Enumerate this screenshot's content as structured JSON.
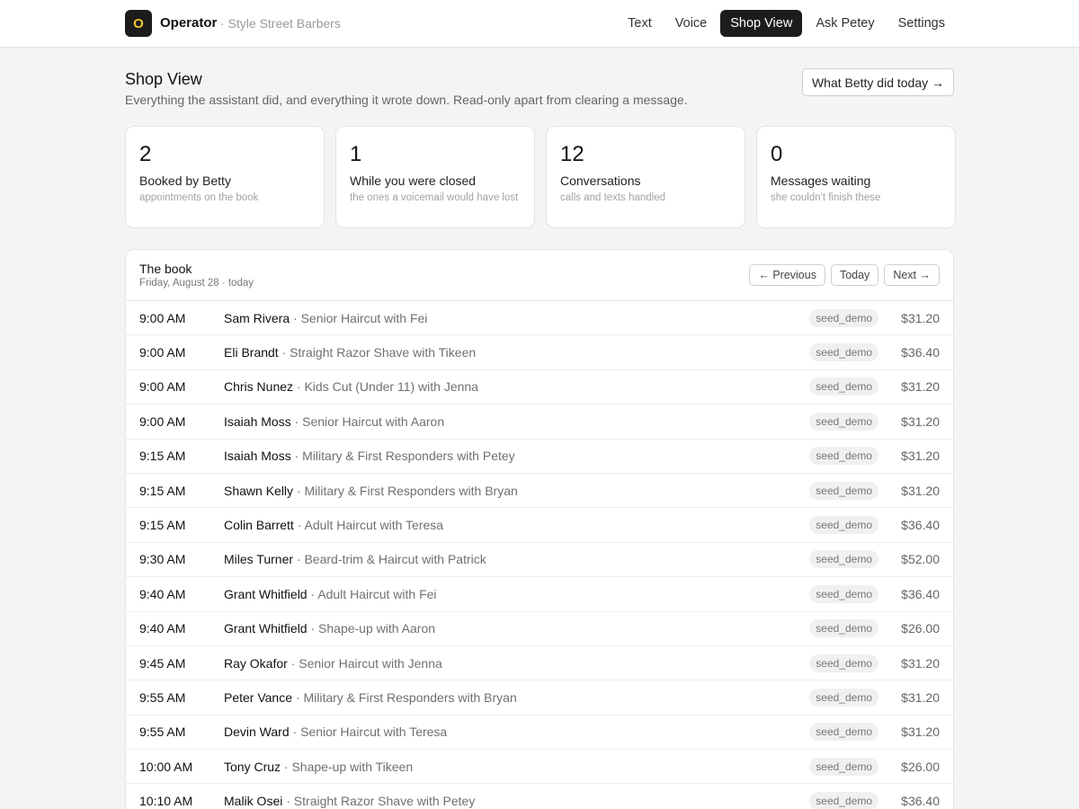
{
  "app": {
    "logo_letter": "O",
    "name": "Operator",
    "shop": "· Style Street Barbers"
  },
  "nav": [
    {
      "label": "Text",
      "active": false
    },
    {
      "label": "Voice",
      "active": false
    },
    {
      "label": "Shop View",
      "active": true
    },
    {
      "label": "Ask Petey",
      "active": false
    },
    {
      "label": "Settings",
      "active": false
    }
  ],
  "header": {
    "title": "Shop View",
    "subtitle": "Everything the assistant did, and everything it wrote down. Read-only apart from clearing a message.",
    "today_button": "What Betty did today →"
  },
  "stats": [
    {
      "value": "2",
      "label": "Booked by Betty",
      "hint": "appointments on the book"
    },
    {
      "value": "1",
      "label": "While you were closed",
      "hint": "the ones a voicemail would have lost"
    },
    {
      "value": "12",
      "label": "Conversations",
      "hint": "calls and texts handled"
    },
    {
      "value": "0",
      "label": "Messages waiting",
      "hint": "she couldn't finish these"
    }
  ],
  "book": {
    "title": "The book",
    "date": "Friday, August 28 · today",
    "prev": "← Previous",
    "today": "Today",
    "next": "Next →",
    "rows": [
      {
        "time": "9:00 AM",
        "name": "Sam Rivera",
        "service": " · Senior Haircut with Fei",
        "tag": "seed_demo",
        "price": "$31.20"
      },
      {
        "time": "9:00 AM",
        "name": "Eli Brandt",
        "service": " · Straight Razor Shave with Tikeen",
        "tag": "seed_demo",
        "price": "$36.40"
      },
      {
        "time": "9:00 AM",
        "name": "Chris Nunez",
        "service": " · Kids Cut (Under 11) with Jenna",
        "tag": "seed_demo",
        "price": "$31.20"
      },
      {
        "time": "9:00 AM",
        "name": "Isaiah Moss",
        "service": " · Senior Haircut with Aaron",
        "tag": "seed_demo",
        "price": "$31.20"
      },
      {
        "time": "9:15 AM",
        "name": "Isaiah Moss",
        "service": " · Military & First Responders with Petey",
        "tag": "seed_demo",
        "price": "$31.20"
      },
      {
        "time": "9:15 AM",
        "name": "Shawn Kelly",
        "service": " · Military & First Responders with Bryan",
        "tag": "seed_demo",
        "price": "$31.20"
      },
      {
        "time": "9:15 AM",
        "name": "Colin Barrett",
        "service": " · Adult Haircut with Teresa",
        "tag": "seed_demo",
        "price": "$36.40"
      },
      {
        "time": "9:30 AM",
        "name": "Miles Turner",
        "service": " · Beard-trim & Haircut with Patrick",
        "tag": "seed_demo",
        "price": "$52.00"
      },
      {
        "time": "9:40 AM",
        "name": "Grant Whitfield",
        "service": " · Adult Haircut with Fei",
        "tag": "seed_demo",
        "price": "$36.40"
      },
      {
        "time": "9:40 AM",
        "name": "Grant Whitfield",
        "service": " · Shape-up with Aaron",
        "tag": "seed_demo",
        "price": "$26.00"
      },
      {
        "time": "9:45 AM",
        "name": "Ray Okafor",
        "service": " · Senior Haircut with Jenna",
        "tag": "seed_demo",
        "price": "$31.20"
      },
      {
        "time": "9:55 AM",
        "name": "Peter Vance",
        "service": " · Military & First Responders with Bryan",
        "tag": "seed_demo",
        "price": "$31.20"
      },
      {
        "time": "9:55 AM",
        "name": "Devin Ward",
        "service": " · Senior Haircut with Teresa",
        "tag": "seed_demo",
        "price": "$31.20"
      },
      {
        "time": "10:00 AM",
        "name": "Tony Cruz",
        "service": " · Shape-up with Tikeen",
        "tag": "seed_demo",
        "price": "$26.00"
      },
      {
        "time": "10:10 AM",
        "name": "Malik Osei",
        "service": " · Straight Razor Shave with Petey",
        "tag": "seed_demo",
        "price": "$36.40"
      }
    ]
  }
}
